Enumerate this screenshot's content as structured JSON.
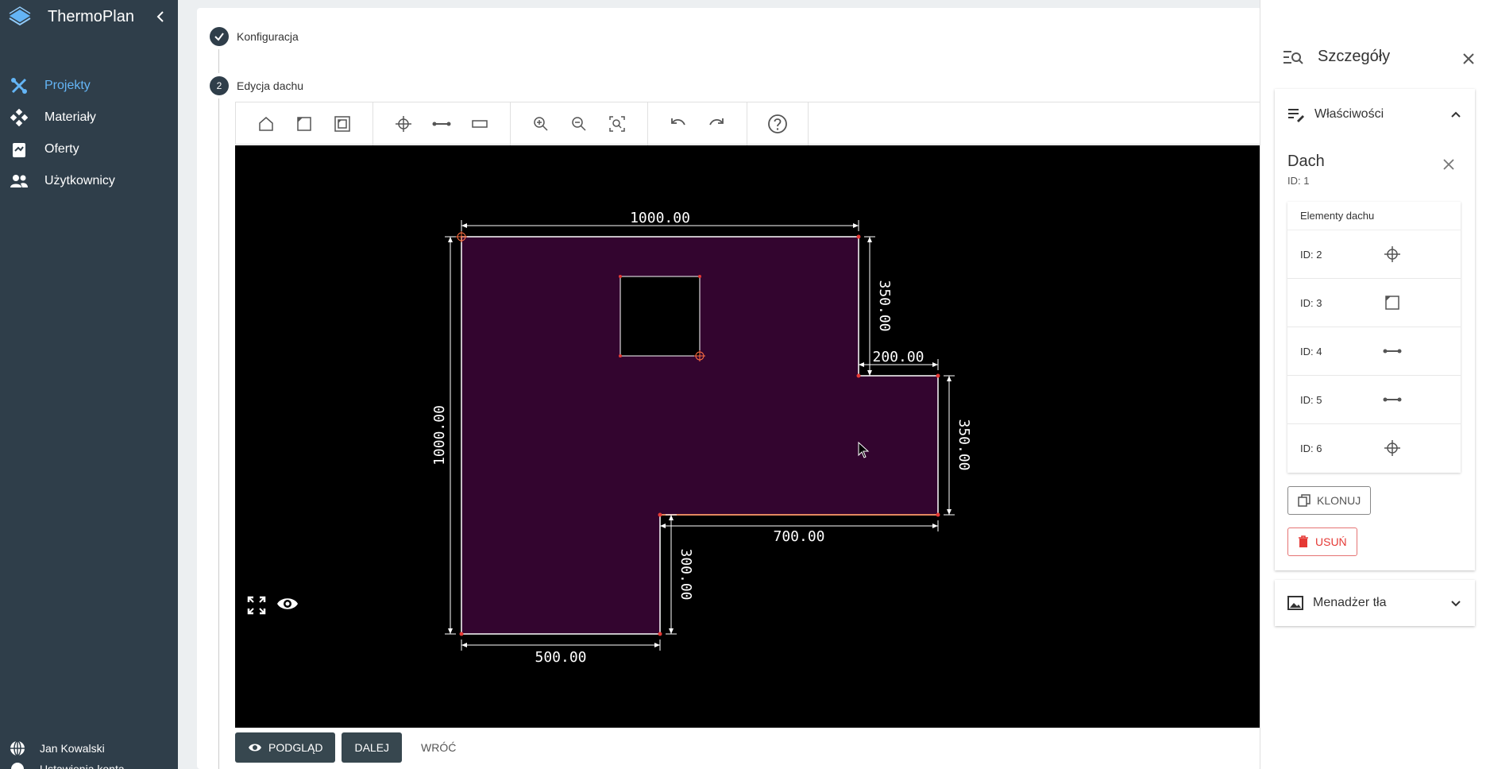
{
  "app": {
    "name": "ThermoPlan"
  },
  "sidebar": {
    "items": [
      {
        "label": "Projekty",
        "icon": "tools-icon",
        "active": true
      },
      {
        "label": "Materiały",
        "icon": "nodes-icon"
      },
      {
        "label": "Oferty",
        "icon": "clipboard-icon"
      },
      {
        "label": "Użytkownicy",
        "icon": "users-icon"
      }
    ],
    "user": "Jan Kowalski",
    "user_sub": "Ustawienia konta"
  },
  "steps": [
    {
      "num": "✓",
      "label": "Konfiguracja"
    },
    {
      "num": "2",
      "label": "Edycja dachu"
    }
  ],
  "canvas": {
    "dimensions": {
      "top": "1000.00",
      "left": "1000.00",
      "right_upper": "350.00",
      "step": "200.00",
      "right_lower": "350.00",
      "bottom_mid": "700.00",
      "inner_vertical": "300.00",
      "bottom": "500.00"
    }
  },
  "actions": {
    "preview": "PODGLĄD",
    "next": "DALEJ",
    "back": "WRÓĆ"
  },
  "panel": {
    "title": "Szczegóły",
    "properties": "Właściwości",
    "object": {
      "name": "Dach",
      "id": "ID: 1"
    },
    "elements_header": "Elementy dachu",
    "elements": [
      {
        "id": "ID: 2",
        "icon": "crosshair-icon"
      },
      {
        "id": "ID: 3",
        "icon": "corner-square-icon"
      },
      {
        "id": "ID: 4",
        "icon": "segment-icon"
      },
      {
        "id": "ID: 5",
        "icon": "segment-icon"
      },
      {
        "id": "ID: 6",
        "icon": "crosshair-icon"
      }
    ],
    "clone": "KLONUJ",
    "delete": "USUŃ",
    "background": "Menadżer tła"
  },
  "colors": {
    "sidebar": "#2f3e4a",
    "active": "#64b5f6",
    "roof_fill": "#33052f",
    "danger": "#e53935"
  }
}
